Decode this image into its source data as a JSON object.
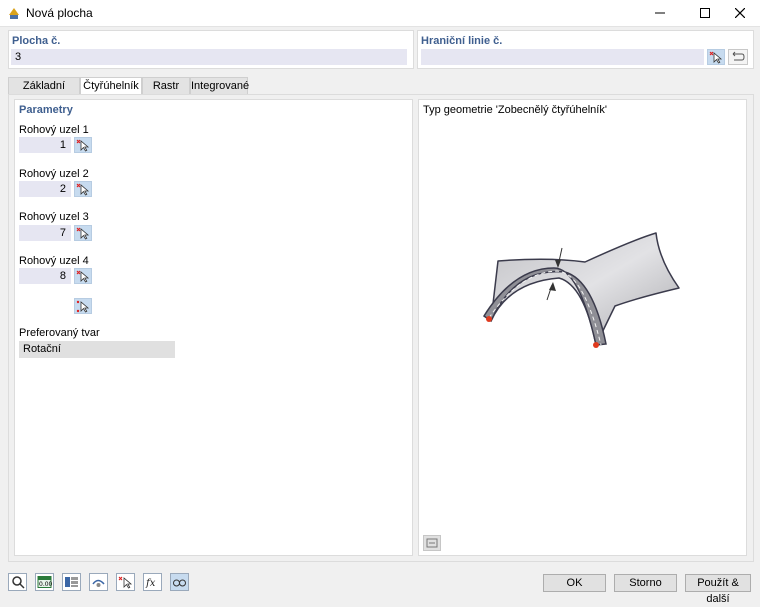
{
  "window": {
    "title": "Nová plocha"
  },
  "plocha": {
    "label": "Plocha č.",
    "value": "3"
  },
  "hranicni": {
    "label": "Hraniční linie č.",
    "value": ""
  },
  "tabs": [
    "Základní údaje",
    "Čtyřúhelník",
    "Rastr",
    "Integrované"
  ],
  "params": {
    "heading": "Parametry",
    "corners": [
      {
        "label": "Rohový uzel 1",
        "value": "1"
      },
      {
        "label": "Rohový uzel 2",
        "value": "2"
      },
      {
        "label": "Rohový uzel 3",
        "value": "7"
      },
      {
        "label": "Rohový uzel 4",
        "value": "8"
      }
    ],
    "pref_label": "Preferovaný tvar",
    "pref_value": "Rotační"
  },
  "geometry": {
    "caption": "Typ geometrie 'Zobecnělý čtyřúhelník'"
  },
  "buttons": {
    "ok": "OK",
    "cancel": "Storno",
    "apply": "Použít & další"
  },
  "colors": {
    "accent_title": "#3f5f8f",
    "field_bg": "#e6e6f2",
    "node_marker": "#e03a1e"
  }
}
